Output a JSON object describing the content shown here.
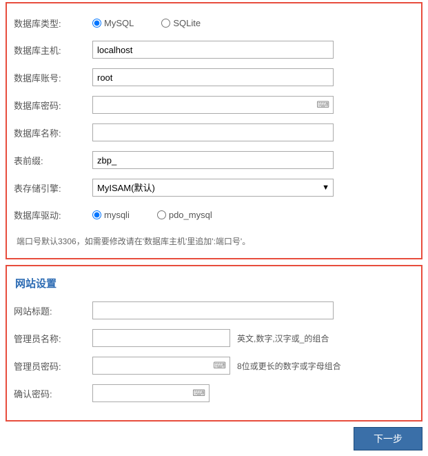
{
  "db": {
    "type_label": "数据库类型:",
    "type_mysql": "MySQL",
    "type_sqlite": "SQLite",
    "host_label": "数据库主机:",
    "host_value": "localhost",
    "user_label": "数据库账号:",
    "user_value": "root",
    "pass_label": "数据库密码:",
    "pass_value": "",
    "name_label": "数据库名称:",
    "name_value": "",
    "prefix_label": "表前缀:",
    "prefix_value": "zbp_",
    "engine_label": "表存储引擎:",
    "engine_value": "MyISAM(默认)",
    "driver_label": "数据库驱动:",
    "driver_mysqli": "mysqli",
    "driver_pdo": "pdo_mysql",
    "port_hint": "端口号默认3306，如需要修改请在'数据库主机'里追加':端口号'。"
  },
  "site": {
    "section_title": "网站设置",
    "title_label": "网站标题:",
    "admin_name_label": "管理员名称:",
    "admin_name_hint": "英文,数字,汉字或_的组合",
    "admin_pass_label": "管理员密码:",
    "admin_pass_hint": "8位或更长的数字或字母组合",
    "confirm_label": "确认密码:"
  },
  "nav": {
    "next": "下一步"
  }
}
